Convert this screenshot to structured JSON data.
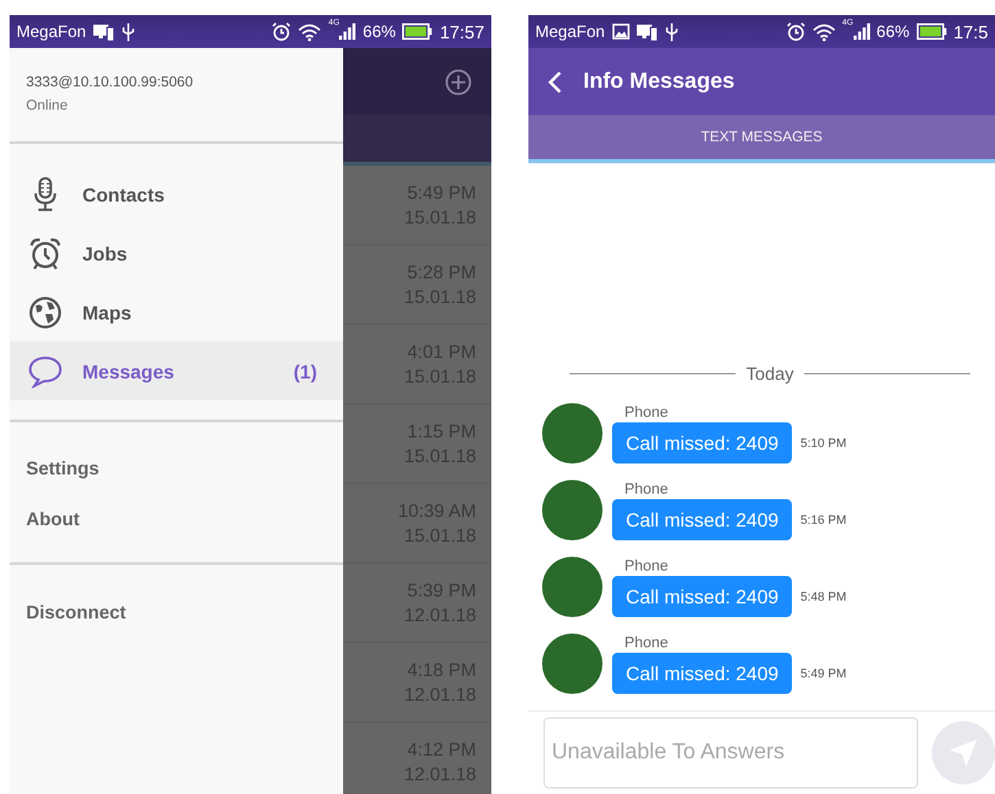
{
  "left_screen": {
    "status_bar": {
      "carrier": "MegaFon",
      "network": "4G",
      "battery": "66%",
      "time": "17:57"
    },
    "drawer": {
      "account": "3333@10.10.100.99:5060",
      "status": "Online",
      "items": [
        {
          "kind": "microphone",
          "label": "Contacts",
          "selected": false
        },
        {
          "kind": "alarm",
          "label": "Jobs",
          "selected": false
        },
        {
          "kind": "globe",
          "label": "Maps",
          "selected": false
        },
        {
          "kind": "chat",
          "label": "Messages",
          "badge": "(1)",
          "selected": true
        }
      ],
      "secondary_items": [
        {
          "label": "Settings"
        },
        {
          "label": "About"
        }
      ],
      "footer_items": [
        {
          "label": "Disconnect"
        }
      ]
    },
    "background_list": {
      "rows": [
        {
          "time": "5:49 PM",
          "date": "15.01.18"
        },
        {
          "time": "5:28 PM",
          "date": "15.01.18"
        },
        {
          "time": "4:01 PM",
          "date": "15.01.18"
        },
        {
          "time": "1:15 PM",
          "date": "15.01.18"
        },
        {
          "time": "10:39 AM",
          "date": "15.01.18"
        },
        {
          "time": "5:39 PM",
          "date": "12.01.18"
        },
        {
          "time": "4:18 PM",
          "date": "12.01.18"
        },
        {
          "time": "4:12 PM",
          "date": "12.01.18"
        }
      ]
    }
  },
  "right_screen": {
    "status_bar": {
      "carrier": "MegaFon",
      "network": "4G",
      "battery": "66%",
      "time": "17:5"
    },
    "title": "Info Messages",
    "tabs": [
      {
        "label": "TEXT MESSAGES",
        "selected": true
      }
    ],
    "date_separator": "Today",
    "messages": [
      {
        "sender": "Phone",
        "text": "Call missed: 2409",
        "time": "5:10 PM"
      },
      {
        "sender": "Phone",
        "text": "Call missed: 2409",
        "time": "5:16 PM"
      },
      {
        "sender": "Phone",
        "text": "Call missed: 2409",
        "time": "5:48 PM"
      },
      {
        "sender": "Phone",
        "text": "Call missed: 2409",
        "time": "5:49 PM"
      }
    ],
    "input": {
      "placeholder": "Unavailable To Answers"
    }
  }
}
